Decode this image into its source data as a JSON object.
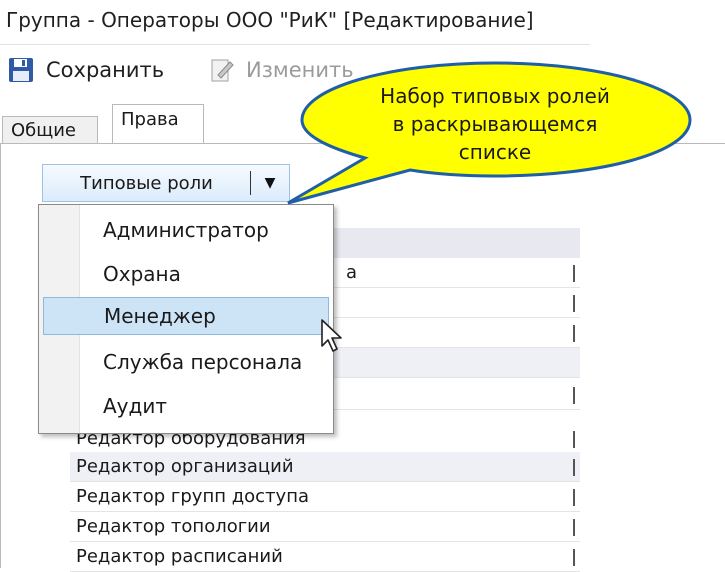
{
  "window": {
    "title": "Группа - Операторы ООО \"РиК\" [Редактирование]"
  },
  "toolbar": {
    "save_label": "Сохранить",
    "edit_label": "Изменить"
  },
  "tabs": [
    {
      "label": "Общие"
    },
    {
      "label": "Права"
    }
  ],
  "split_button": {
    "label": "Типовые роли",
    "arrow": "▼"
  },
  "dropdown": {
    "items": [
      {
        "label": "Администратор"
      },
      {
        "label": "Охрана"
      },
      {
        "label": "Менеджер"
      },
      {
        "label": "Служба персонала"
      },
      {
        "label": "Аудит"
      }
    ],
    "selected": "Менеджер"
  },
  "grid": {
    "partial_row_suffix": "а",
    "rows": [
      {
        "label": "Редактор оборудования"
      },
      {
        "label": "Редактор организаций"
      },
      {
        "label": "Редактор групп доступа"
      },
      {
        "label": "Редактор топологии"
      },
      {
        "label": "Редактор расписаний"
      }
    ]
  },
  "callout": {
    "lines": [
      "Набор типовых ролей",
      "в раскрывающемся",
      "списке"
    ],
    "fill_color": "#ffff00",
    "border_color": "#1f5fa8"
  },
  "colors": {
    "selection": "#cde4f7",
    "accent": "#1f5fa8"
  }
}
